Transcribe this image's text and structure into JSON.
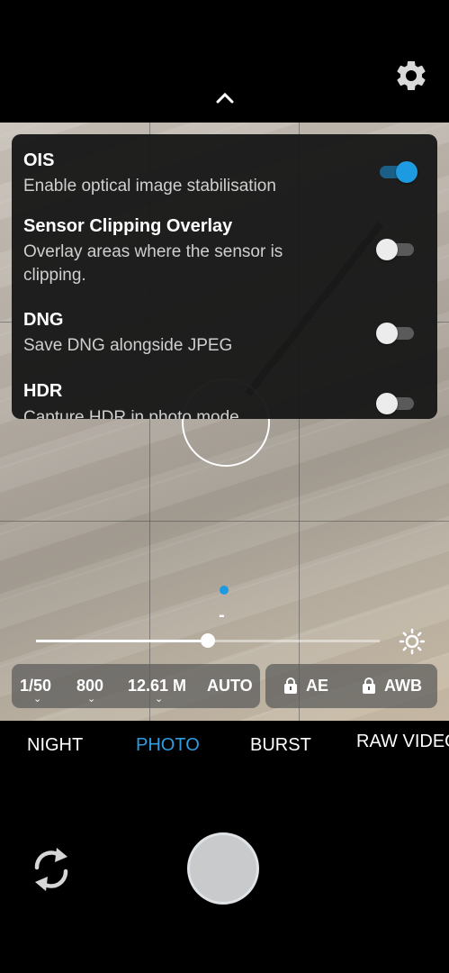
{
  "settings_panel": {
    "items": [
      {
        "title": "OIS",
        "description": "Enable optical image stabilisation",
        "enabled": true
      },
      {
        "title": "Sensor Clipping Overlay",
        "description": "Overlay areas where the sensor is clipping.",
        "enabled": false
      },
      {
        "title": "DNG",
        "description": "Save DNG alongside JPEG",
        "enabled": false
      },
      {
        "title": "HDR",
        "description": "Capture HDR in photo mode",
        "enabled": false
      }
    ]
  },
  "exposure": {
    "indicator": "-",
    "level": 0.5
  },
  "params": {
    "shutter": "1/50",
    "iso": "800",
    "resolution": "12.61 M",
    "mode": "AUTO",
    "ae_label": "AE",
    "awb_label": "AWB"
  },
  "modes": [
    {
      "label": "NIGHT",
      "active": false
    },
    {
      "label": "PHOTO",
      "active": true
    },
    {
      "label": "BURST",
      "active": false
    },
    {
      "label": "RAW VIDEO",
      "active": false
    }
  ],
  "colors": {
    "accent": "#1e9be0",
    "active_mode": "#2d9de0"
  },
  "icons": [
    "gear-icon",
    "chevron-up-icon",
    "brightness-icon",
    "lock-icon",
    "switch-camera-icon"
  ]
}
